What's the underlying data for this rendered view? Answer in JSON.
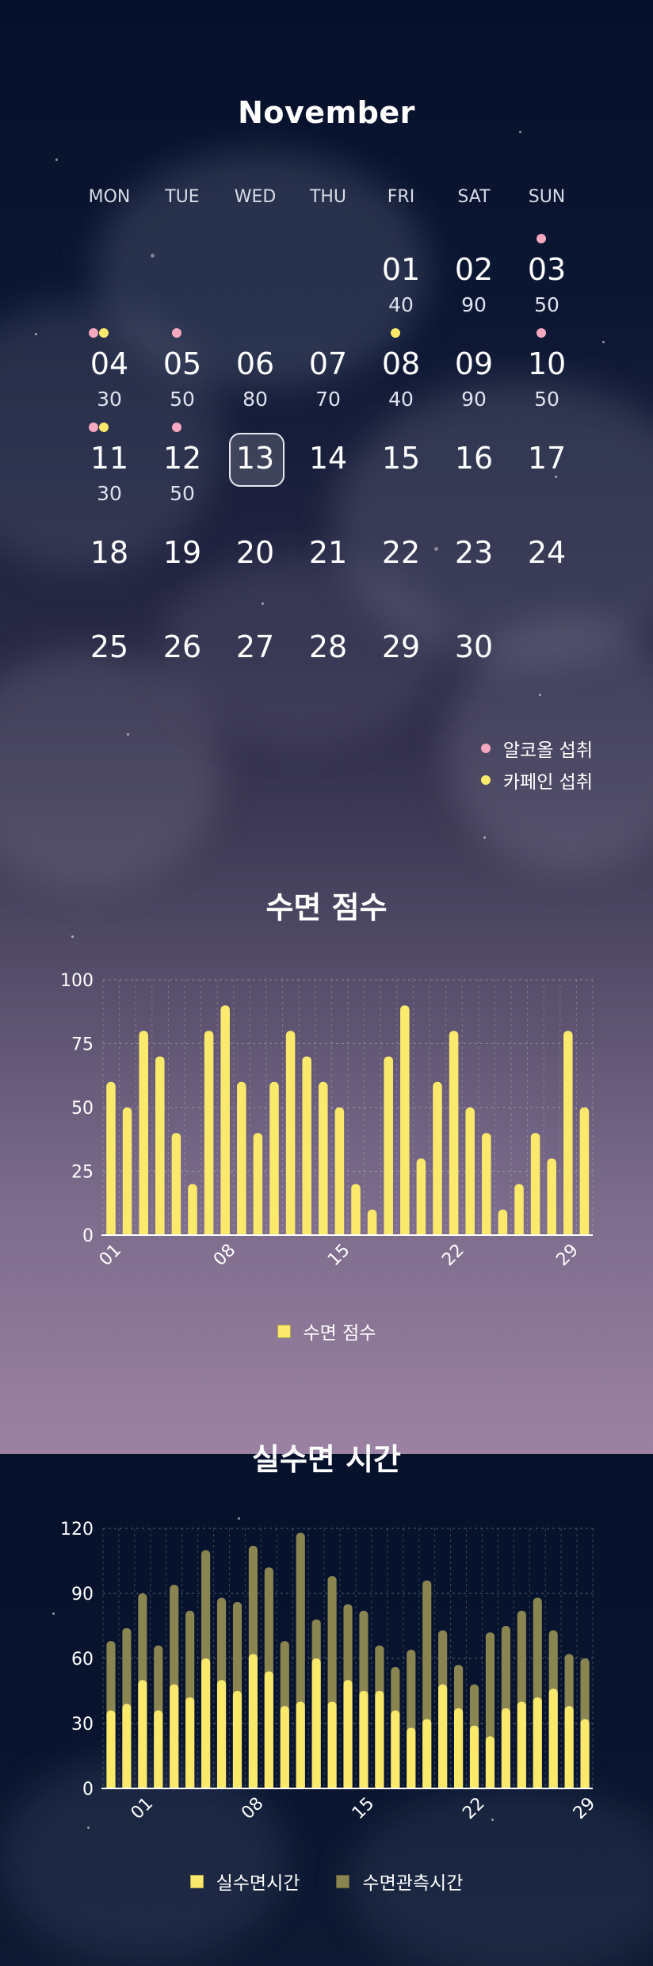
{
  "calendar": {
    "month": "November",
    "weekdays": [
      "MON",
      "TUE",
      "WED",
      "THU",
      "FRI",
      "SAT",
      "SUN"
    ],
    "today": "13",
    "days": [
      {
        "num": "01",
        "col": 4,
        "row": 0,
        "score": "40",
        "dots": []
      },
      {
        "num": "02",
        "col": 5,
        "row": 0,
        "score": "90",
        "dots": []
      },
      {
        "num": "03",
        "col": 6,
        "row": 0,
        "score": "50",
        "dots": [
          "pink"
        ]
      },
      {
        "num": "04",
        "col": 0,
        "row": 1,
        "score": "30",
        "dots": [
          "pink",
          "yellow"
        ]
      },
      {
        "num": "05",
        "col": 1,
        "row": 1,
        "score": "50",
        "dots": [
          "pink"
        ]
      },
      {
        "num": "06",
        "col": 2,
        "row": 1,
        "score": "80",
        "dots": []
      },
      {
        "num": "07",
        "col": 3,
        "row": 1,
        "score": "70",
        "dots": []
      },
      {
        "num": "08",
        "col": 4,
        "row": 1,
        "score": "40",
        "dots": [
          "yellow"
        ]
      },
      {
        "num": "09",
        "col": 5,
        "row": 1,
        "score": "90",
        "dots": []
      },
      {
        "num": "10",
        "col": 6,
        "row": 1,
        "score": "50",
        "dots": [
          "pink"
        ]
      },
      {
        "num": "11",
        "col": 0,
        "row": 2,
        "score": "30",
        "dots": [
          "pink",
          "yellow"
        ]
      },
      {
        "num": "12",
        "col": 1,
        "row": 2,
        "score": "50",
        "dots": [
          "pink"
        ]
      },
      {
        "num": "13",
        "col": 2,
        "row": 2,
        "score": "",
        "dots": []
      },
      {
        "num": "14",
        "col": 3,
        "row": 2,
        "score": "",
        "dots": []
      },
      {
        "num": "15",
        "col": 4,
        "row": 2,
        "score": "",
        "dots": []
      },
      {
        "num": "16",
        "col": 5,
        "row": 2,
        "score": "",
        "dots": []
      },
      {
        "num": "17",
        "col": 6,
        "row": 2,
        "score": "",
        "dots": []
      },
      {
        "num": "18",
        "col": 0,
        "row": 3,
        "score": "",
        "dots": []
      },
      {
        "num": "19",
        "col": 1,
        "row": 3,
        "score": "",
        "dots": []
      },
      {
        "num": "20",
        "col": 2,
        "row": 3,
        "score": "",
        "dots": []
      },
      {
        "num": "21",
        "col": 3,
        "row": 3,
        "score": "",
        "dots": []
      },
      {
        "num": "22",
        "col": 4,
        "row": 3,
        "score": "",
        "dots": []
      },
      {
        "num": "23",
        "col": 5,
        "row": 3,
        "score": "",
        "dots": []
      },
      {
        "num": "24",
        "col": 6,
        "row": 3,
        "score": "",
        "dots": []
      },
      {
        "num": "25",
        "col": 0,
        "row": 4,
        "score": "",
        "dots": []
      },
      {
        "num": "26",
        "col": 1,
        "row": 4,
        "score": "",
        "dots": []
      },
      {
        "num": "27",
        "col": 2,
        "row": 4,
        "score": "",
        "dots": []
      },
      {
        "num": "28",
        "col": 3,
        "row": 4,
        "score": "",
        "dots": []
      },
      {
        "num": "29",
        "col": 4,
        "row": 4,
        "score": "",
        "dots": []
      },
      {
        "num": "30",
        "col": 5,
        "row": 4,
        "score": "",
        "dots": []
      }
    ]
  },
  "legend": {
    "alcohol": {
      "label": "알코올 섭취",
      "color": "#f5a8c0"
    },
    "caffeine": {
      "label": "카페인 섭취",
      "color": "#fbe96c"
    }
  },
  "chart_data": [
    {
      "type": "bar",
      "title": "수면 점수",
      "x": [
        "01",
        "02",
        "03",
        "04",
        "05",
        "06",
        "07",
        "08",
        "09",
        "10",
        "11",
        "12",
        "13",
        "14",
        "15",
        "16",
        "17",
        "18",
        "19",
        "20",
        "21",
        "22",
        "23",
        "24",
        "25",
        "26",
        "27",
        "28",
        "29",
        "30"
      ],
      "xticks": [
        "01",
        "08",
        "15",
        "22",
        "29"
      ],
      "yticks": [
        0,
        25,
        50,
        75,
        100
      ],
      "ylim": [
        0,
        100
      ],
      "series": [
        {
          "name": "수면 점수",
          "color": "#fbe96c",
          "values": [
            60,
            50,
            80,
            70,
            40,
            20,
            80,
            90,
            60,
            40,
            60,
            80,
            70,
            60,
            50,
            20,
            10,
            70,
            90,
            30,
            60,
            80,
            50,
            40,
            10,
            20,
            40,
            30,
            80,
            50
          ]
        }
      ],
      "grid": true,
      "legend": "bottom"
    },
    {
      "type": "bar",
      "title": "실수면 시간",
      "x": [
        "01",
        "02",
        "03",
        "04",
        "05",
        "06",
        "07",
        "08",
        "09",
        "10",
        "11",
        "12",
        "13",
        "14",
        "15",
        "16",
        "17",
        "18",
        "19",
        "20",
        "21",
        "22",
        "23",
        "24",
        "25",
        "26",
        "27",
        "28",
        "29",
        "30"
      ],
      "xticks": [
        "01",
        "08",
        "15",
        "22",
        "29"
      ],
      "yticks": [
        0,
        30,
        60,
        90,
        120
      ],
      "ylim": [
        0,
        120
      ],
      "series": [
        {
          "name": "실수면시간",
          "color": "#fbe96c",
          "values": [
            36,
            39,
            50,
            36,
            48,
            42,
            60,
            50,
            45,
            62,
            54,
            38,
            40,
            60,
            40,
            50,
            45,
            45,
            36,
            28,
            32,
            48,
            37,
            29,
            24,
            37,
            40,
            42,
            46,
            38,
            32
          ]
        },
        {
          "name": "수면관측시간",
          "color": "#8a8450",
          "values": [
            68,
            74,
            90,
            66,
            94,
            82,
            110,
            88,
            86,
            112,
            102,
            68,
            118,
            78,
            98,
            85,
            82,
            66,
            56,
            64,
            96,
            73,
            57,
            48,
            72,
            75,
            82,
            88,
            73,
            62,
            60
          ]
        }
      ],
      "grid": true,
      "legend": "bottom"
    }
  ]
}
